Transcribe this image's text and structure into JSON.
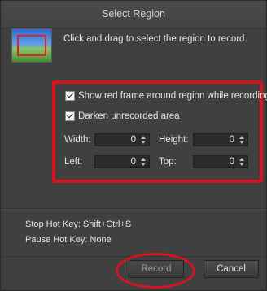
{
  "window": {
    "title": "Select Region"
  },
  "instruction": "Click and drag to select the region to record.",
  "options": {
    "show_red_frame": {
      "label": "Show red frame around region while recording",
      "checked": true
    },
    "darken_unrecorded": {
      "label": "Darken unrecorded area",
      "checked": true
    }
  },
  "fields": {
    "width": {
      "label": "Width:",
      "value": "0"
    },
    "height": {
      "label": "Height:",
      "value": "0"
    },
    "left": {
      "label": "Left:",
      "value": "0"
    },
    "top": {
      "label": "Top:",
      "value": "0"
    }
  },
  "hotkeys": {
    "stop": "Stop Hot Key: Shift+Ctrl+S",
    "pause": "Pause Hot Key: None"
  },
  "buttons": {
    "record": {
      "label": "Record",
      "enabled": false
    },
    "cancel": {
      "label": "Cancel",
      "enabled": true
    }
  },
  "colors": {
    "annotation": "#d4141e",
    "background": "#404040"
  },
  "icons": {
    "region_thumbnail": "screen-region-preview-icon"
  }
}
